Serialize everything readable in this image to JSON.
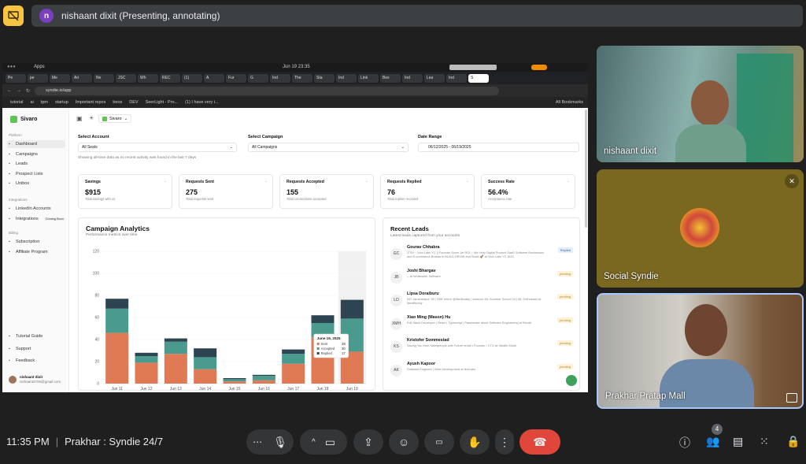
{
  "meet": {
    "presenter_initial": "n",
    "presenting_banner": "nishaant dixit (Presenting, annotating)",
    "clock": "11:35 PM",
    "separator": "|",
    "meeting_name": "Prakhar : Syndie 24/7",
    "people_count": "4",
    "participants": [
      {
        "name": "nishaant dixit"
      },
      {
        "name": "Social Syndie"
      },
      {
        "name": "Prakhar Pratap Mall"
      }
    ]
  },
  "browser": {
    "os_app": "Apps",
    "os_clock": "Jun 19  23:35",
    "url": "syndie.io/app",
    "tabs": [
      "Pe",
      "pe",
      "Me",
      "Ari",
      "Ne",
      "JSC",
      "Wh",
      "REC",
      "(1)",
      "A",
      "Fur",
      "G",
      "Ind",
      "The",
      "Sta",
      "Ind",
      "Link",
      "Bes",
      "Ind",
      "Lea",
      "Ind",
      "S"
    ],
    "bookmarks": [
      "tutorial",
      "ai",
      "tpm",
      "startup",
      "Important repos",
      "beos",
      "DEV",
      "SeerLight - Pro...",
      "(1) I have very i..."
    ],
    "all_bookmarks": "All Bookmarks"
  },
  "app": {
    "brand": "Sivaro",
    "workspace": "Sivaro",
    "sidebar": {
      "platform_label": "Platform",
      "platform_items": [
        "Dashboard",
        "Campaigns",
        "Leads",
        "Prospect Lists",
        "Unibox"
      ],
      "integrations_label": "Integrations",
      "integration_items": [
        "LinkedIn Accounts",
        "Integrations"
      ],
      "coming_soon": "Coming Soon",
      "billing_label": "Billing",
      "billing_items": [
        "Subscription",
        "Affiliate Program"
      ],
      "footer_items": [
        "Tutorial Guide",
        "Support",
        "Feedback"
      ],
      "user_name": "nishaant dixit",
      "user_email": "nishaant2706@gmail.com"
    },
    "filters": {
      "account_label": "Select Account",
      "account_value": "All Seats",
      "campaign_label": "Select Campaign",
      "campaign_value": "All Campaigns",
      "date_label": "Date Range",
      "date_value": "06/12/2025 - 06/19/2025",
      "note": "Showing all-time data as no recent activity was found in the last 7 days"
    },
    "stats": [
      {
        "title": "Savings",
        "value": "$915",
        "sub": "Total savings with us"
      },
      {
        "title": "Requests Sent",
        "value": "275",
        "sub": "Total requests sent"
      },
      {
        "title": "Requests Accepted",
        "value": "155",
        "sub": "Total connections accepted"
      },
      {
        "title": "Requests Replied",
        "value": "76",
        "sub": "Total replies received"
      },
      {
        "title": "Success Rate",
        "value": "56.4%",
        "sub": "Acceptance rate"
      }
    ],
    "analytics": {
      "title": "Campaign Analytics",
      "subtitle": "Performance metrics over time"
    },
    "leads": {
      "title": "Recent Leads",
      "subtitle": "Latest leads captured from your accounts",
      "items": [
        {
          "initials": "GC",
          "name": "Gourav Chhabra",
          "desc": "GTM ~ Viva Labs YC || Founder Scom Jet ROI ~ We Help Digital Product SaaS Software Businesses and E-commerce Brands in BUILD GROW and Scale 🚀 at Viva Labs YC W23",
          "status": "Replied",
          "status_class": "replied"
        },
        {
          "initials": "JB",
          "name": "Joshi Bhargav",
          "desc": "-- at Whitestork Software",
          "status": "pending",
          "status_class": "pending"
        },
        {
          "initials": "LD",
          "name": "Lipsa Doraiburu",
          "desc": "NIT Jamshedpur '25 | SDE Intern @Medbuddy | Amazon ML Summer School 24 | ML Enthusiast at MediBuddy",
          "status": "pending",
          "status_class": "pending"
        },
        {
          "initials": "XMH",
          "name": "Xiao Ming (Mason) Hu",
          "desc": "Full Stack Developer | React | Typescript | Passionate about Software Engineering at Recall",
          "status": "pending",
          "status_class": "pending"
        },
        {
          "initials": "KS",
          "name": "Kristofer Sommestad",
          "desc": "Saving You from Salespeople with Future email • Founder / CTO at Stealth Mode",
          "status": "pending",
          "status_class": "pending"
        },
        {
          "initials": "AK",
          "name": "Ayush Kapoor",
          "desc": "Software Engineer | Web Development at NetLabs",
          "status": "pending",
          "status_class": "pending"
        }
      ]
    }
  },
  "chart_data": {
    "type": "bar",
    "stacked": true,
    "categories": [
      "Jun 11",
      "Jun 12",
      "Jun 13",
      "Jun 14",
      "Jun 15",
      "Jun 16",
      "Jun 17",
      "Jun 18",
      "Jun 19"
    ],
    "series": [
      {
        "name": "Sent",
        "color": "#e07a55",
        "values": [
          46,
          19,
          27,
          13,
          2,
          3,
          18,
          42,
          29
        ]
      },
      {
        "name": "Accepted",
        "color": "#4a9a8d",
        "values": [
          22,
          6,
          11,
          11,
          2,
          4,
          9,
          13,
          30
        ]
      },
      {
        "name": "Replied",
        "color": "#2d4453",
        "values": [
          9,
          3,
          3,
          8,
          1,
          1,
          4,
          7,
          17
        ]
      }
    ],
    "ylim": [
      0,
      120
    ],
    "yticks": [
      0,
      20,
      40,
      60,
      80,
      100,
      120
    ],
    "tooltip": {
      "date": "June 19, 2025",
      "labels": [
        "Sent",
        "Accepted",
        "Replied"
      ],
      "values": [
        "29",
        "30",
        "17"
      ]
    }
  }
}
